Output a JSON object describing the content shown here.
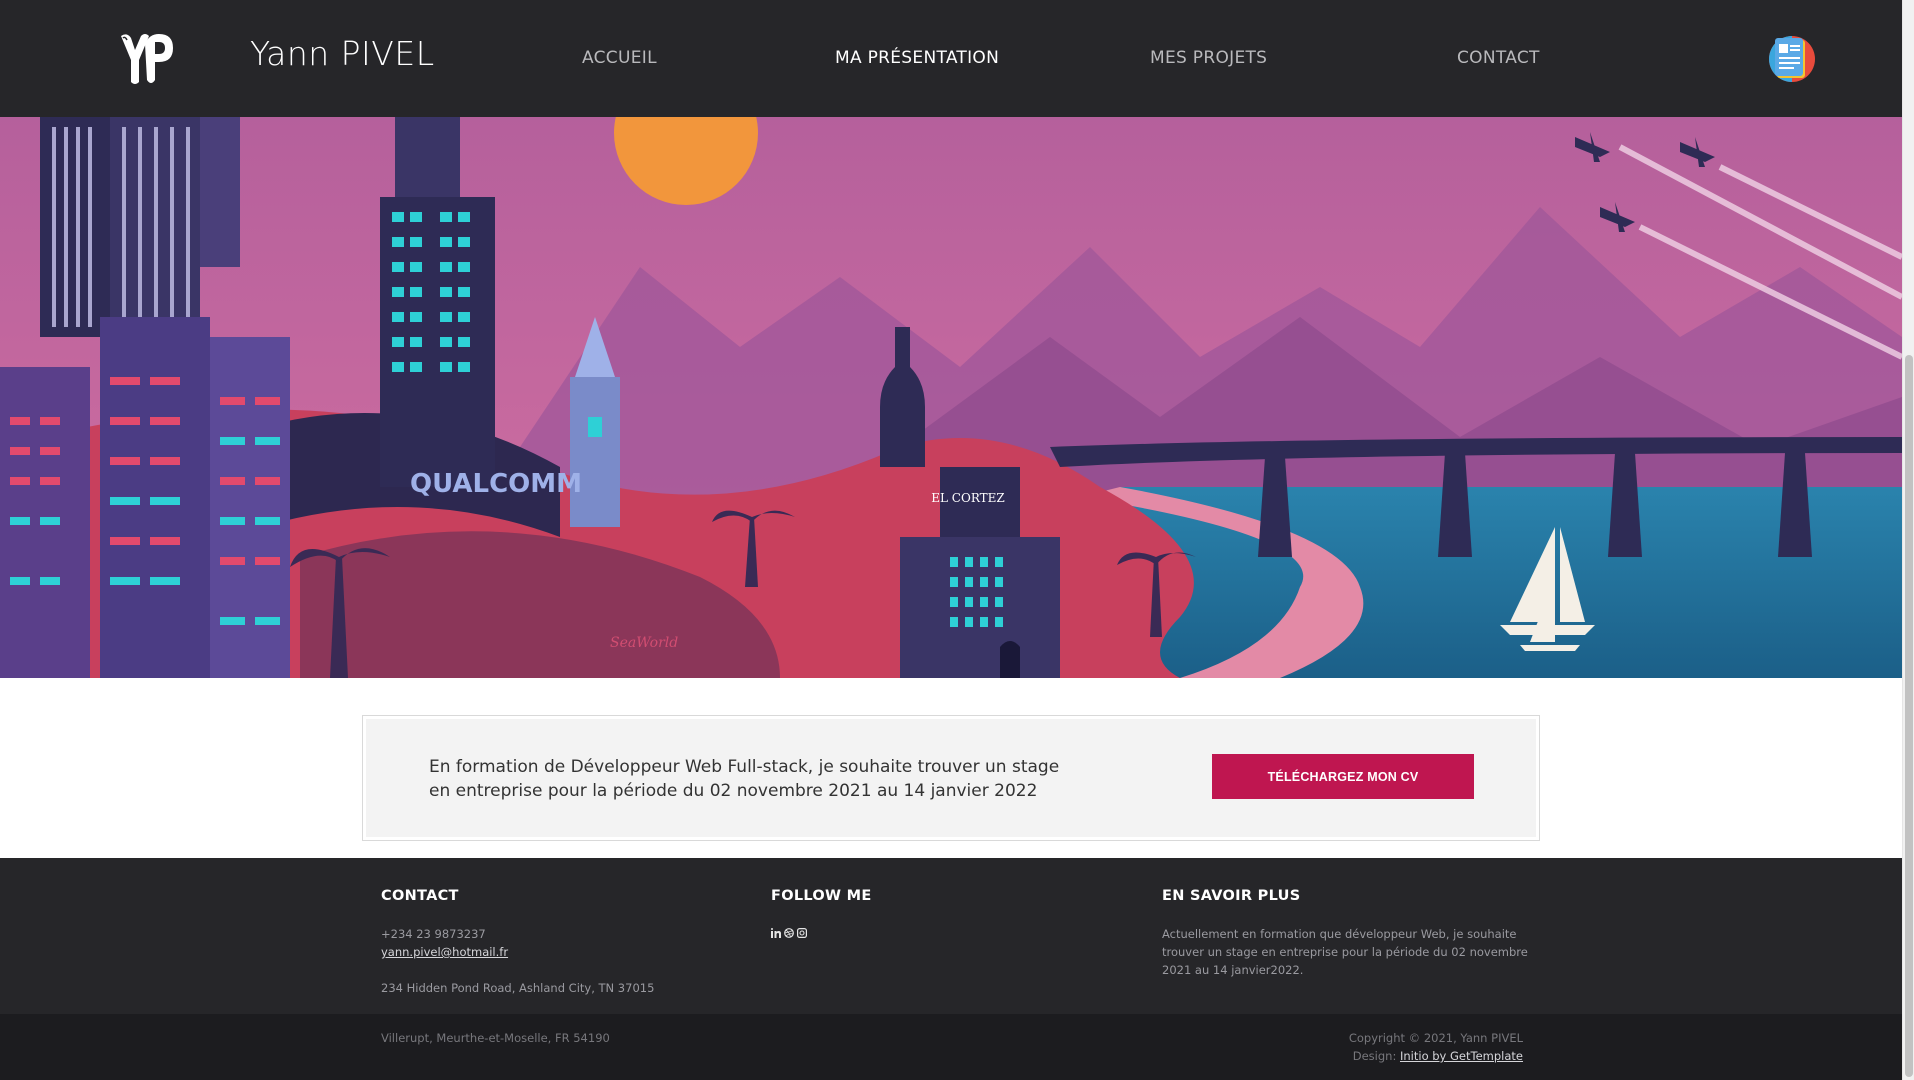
{
  "header": {
    "site_name": "Yann PIVEL",
    "nav": [
      {
        "label": "ACCUEIL",
        "active": false
      },
      {
        "label": "MA PRÉSENTATION",
        "active": true
      },
      {
        "label": "MES PROJETS",
        "active": false
      },
      {
        "label": "CONTACT",
        "active": false
      }
    ],
    "logo_icon": "yp-monogram-logo",
    "cv_icon": "resume-icon"
  },
  "hero": {
    "illustration": "city-skyline-illustration",
    "signs": {
      "qualcomm": "QUALCOMM",
      "el_cortez": "EL CORTEZ",
      "seaworld": "SeaWorld"
    }
  },
  "callout": {
    "text": "En formation de Développeur Web Full-stack, je souhaite trouver un stage en entreprise pour la période du 02 novembre 2021 au 14 janvier 2022",
    "button_label": "TÉLÉCHARGEZ MON CV",
    "button_color": "#bf1650"
  },
  "footer": {
    "contact": {
      "heading": "CONTACT",
      "phone": "+234 23 9873237",
      "email": "yann.pivel@hotmail.fr",
      "address": "234 Hidden Pond Road, Ashland City, TN 37015"
    },
    "follow": {
      "heading": "FOLLOW ME",
      "icons": [
        "linkedin-icon",
        "dribbble-icon",
        "instagram-icon"
      ]
    },
    "about": {
      "heading": "EN SAVOIR PLUS",
      "text": "Actuellement en formation que développeur Web, je souhaite trouver un stage en entreprise pour la période du 02 novembre 2021 au 14 janvier2022."
    },
    "bottom": {
      "location": "Villerupt, Meurthe-et-Moselle, FR 54190",
      "copyright": "Copyright © 2021, Yann PIVEL",
      "design_prefix": "Design:",
      "design_link": "Initio by GetTemplate"
    }
  },
  "colors": {
    "header_bg": "#262629",
    "footer_bg": "#262629",
    "footer_bottom_bg": "#1c1c1f",
    "accent": "#bf1650",
    "sky_top": "#b0609a",
    "sea": "#1e6f99"
  }
}
